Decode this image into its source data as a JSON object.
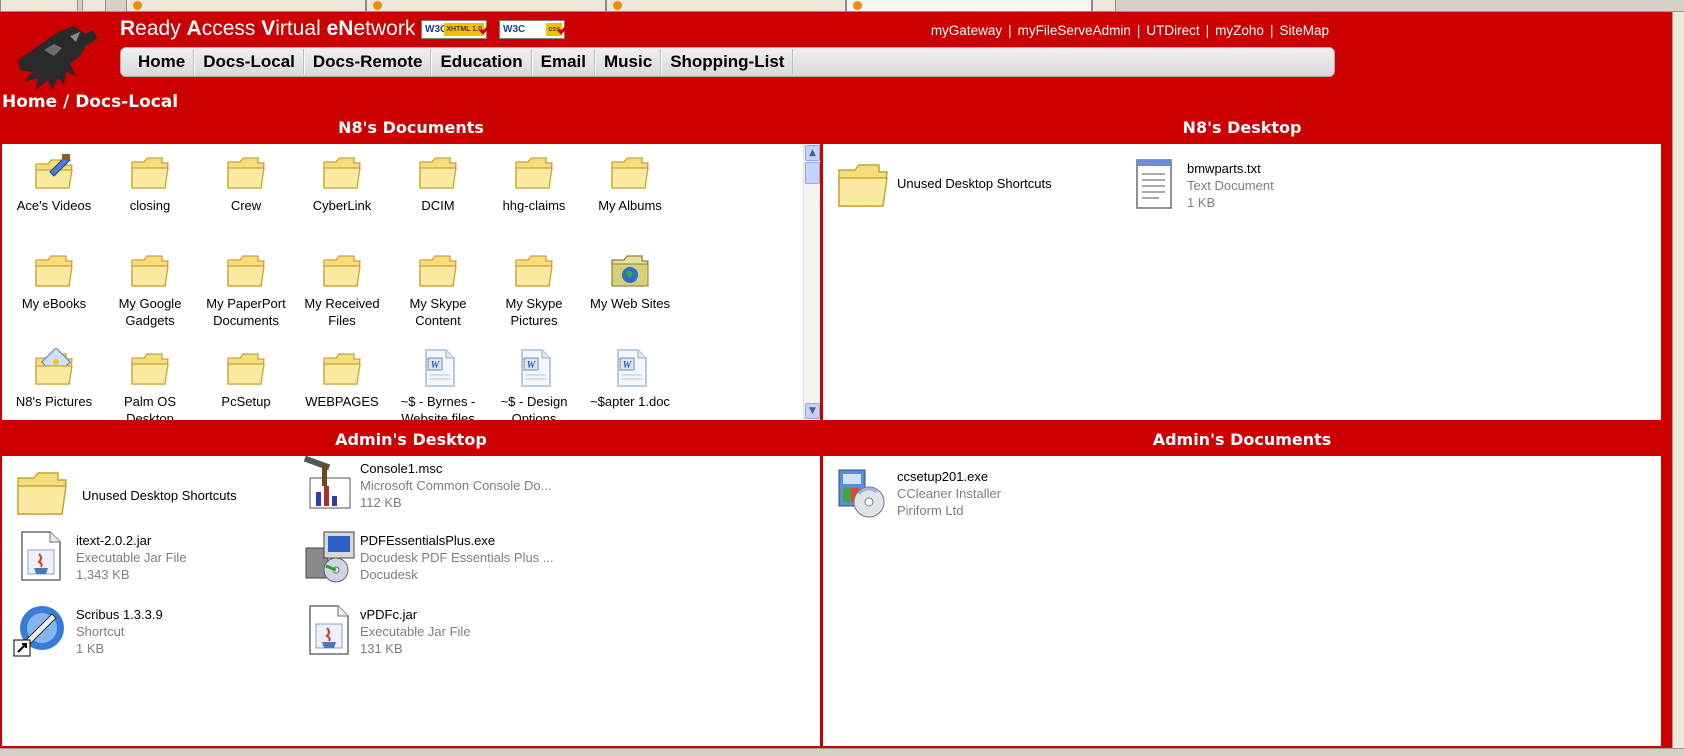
{
  "site": {
    "title_parts": [
      {
        "bold": true,
        "text": "R"
      },
      {
        "bold": false,
        "text": "eady "
      },
      {
        "bold": true,
        "text": "A"
      },
      {
        "bold": false,
        "text": "ccess "
      },
      {
        "bold": true,
        "text": "V"
      },
      {
        "bold": false,
        "text": "irtual "
      },
      {
        "bold": true,
        "text": "eN"
      },
      {
        "bold": false,
        "text": "etwork"
      }
    ],
    "badges": [
      {
        "label": "W3C",
        "tag": "XHTML 1.0"
      },
      {
        "label": "W3C",
        "tag": "css"
      }
    ]
  },
  "top_links": [
    "myGateway",
    "myFileServeAdmin",
    "UTDirect",
    "myZoho",
    "SiteMap"
  ],
  "nav": [
    "Home",
    "Docs-Local",
    "Docs-Remote",
    "Education",
    "Email",
    "Music",
    "Shopping-List"
  ],
  "breadcrumb": "Home / Docs-Local",
  "panels": {
    "n8_documents": {
      "title": "N8's Documents",
      "items": [
        {
          "label": "Ace's Videos",
          "icon": "folder-video-icon"
        },
        {
          "label": "closing",
          "icon": "folder-icon"
        },
        {
          "label": "Crew",
          "icon": "folder-icon"
        },
        {
          "label": "CyberLink",
          "icon": "folder-icon"
        },
        {
          "label": "DCIM",
          "icon": "folder-icon"
        },
        {
          "label": "hhg-claims",
          "icon": "folder-icon"
        },
        {
          "label": "My Albums",
          "icon": "folder-icon"
        },
        {
          "label": "My eBooks",
          "icon": "folder-icon"
        },
        {
          "label": "My Google Gadgets",
          "icon": "folder-icon"
        },
        {
          "label": "My PaperPort Documents",
          "icon": "folder-icon"
        },
        {
          "label": "My Received Files",
          "icon": "folder-icon"
        },
        {
          "label": "My Skype Content",
          "icon": "folder-icon"
        },
        {
          "label": "My Skype Pictures",
          "icon": "folder-icon"
        },
        {
          "label": "My Web Sites",
          "icon": "folder-globe-icon"
        },
        {
          "label": "N8's Pictures",
          "icon": "folder-pictures-icon"
        },
        {
          "label": "Palm OS Desktop",
          "icon": "folder-icon"
        },
        {
          "label": "PcSetup",
          "icon": "folder-icon"
        },
        {
          "label": "WEBPAGES",
          "icon": "folder-icon"
        },
        {
          "label": "~$ - Byrnes - Website files",
          "icon": "word-doc-icon"
        },
        {
          "label": "~$ - Design Options",
          "icon": "word-doc-icon"
        },
        {
          "label": "~$apter 1.doc",
          "icon": "word-doc-icon"
        }
      ]
    },
    "n8_desktop": {
      "title": "N8's Desktop",
      "items": [
        {
          "name": "Unused Desktop Shortcuts",
          "icon": "folder-icon"
        },
        {
          "name": "bmwparts.txt",
          "type": "Text Document",
          "size": "1 KB",
          "icon": "text-file-icon"
        }
      ]
    },
    "admin_desktop": {
      "title": "Admin's Desktop",
      "items": [
        {
          "name": "Unused Desktop Shortcuts",
          "icon": "folder-icon"
        },
        {
          "name": "Console1.msc",
          "type": "Microsoft Common Console Do...",
          "size": "112 KB",
          "icon": "console-icon"
        },
        {
          "name": "itext-2.0.2.jar",
          "type": "Executable Jar File",
          "size": "1,343 KB",
          "icon": "jar-file-icon"
        },
        {
          "name": "PDFEssentialsPlus.exe",
          "type": "Docudesk PDF Essentials Plus ...",
          "size": "Docudesk",
          "icon": "installer-icon"
        },
        {
          "name": "Scribus 1.3.3.9",
          "type": "Shortcut",
          "size": "1 KB",
          "icon": "scribus-shortcut-icon"
        },
        {
          "name": "vPDFc.jar",
          "type": "Executable Jar File",
          "size": "131 KB",
          "icon": "jar-file-icon"
        }
      ]
    },
    "admin_documents": {
      "title": "Admin's Documents",
      "items": [
        {
          "name": "ccsetup201.exe",
          "type": "CCleaner Installer",
          "size": "Piriform Ltd",
          "icon": "installer-cd-icon"
        }
      ]
    }
  },
  "colors": {
    "accent": "#cc0000",
    "folder": "#f5dd7a",
    "folder_edge": "#c9a43a",
    "link_text": "#ffffff"
  }
}
